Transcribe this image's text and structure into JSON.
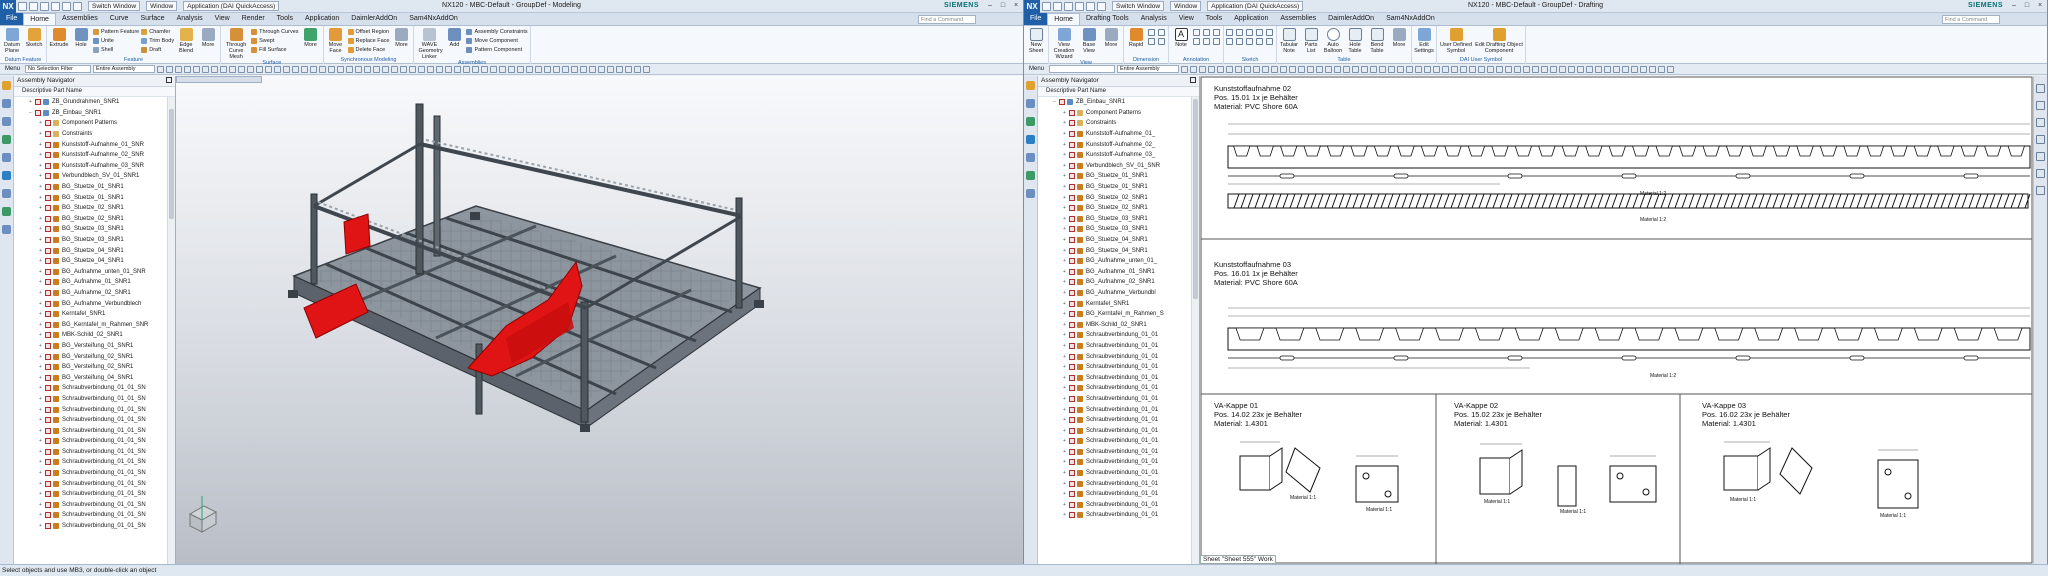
{
  "left": {
    "title": "NX120 - MBC-Default - GroupDef - Modeling",
    "logo": "NX",
    "siemens": "SIEMENS",
    "switch_window": "Switch Window",
    "window_menu": "Window",
    "application_menu": "Application (DAI QuickAccess)",
    "find_placeholder": "Find a Command",
    "tabs": [
      "File",
      "Home",
      "Assemblies",
      "Curve",
      "Surface",
      "Analysis",
      "View",
      "Render",
      "Tools",
      "Application",
      "DaimlerAddOn",
      "Sam4NxAddOn"
    ],
    "active_tab": "Home",
    "ribbon": {
      "datum_plane": "Datum Plane",
      "sketch": "Sketch",
      "extrude": "Extrude",
      "hole": "Hole",
      "pattern_feature": "Pattern Feature",
      "unite": "Unite",
      "shell": "Shell",
      "chamfer": "Chamfer",
      "trim_body": "Trim Body",
      "draft": "Draft",
      "edge_blend": "Edge Blend",
      "more": "More",
      "through_curve_mesh": "Through Curve Mesh",
      "through_curves": "Through Curves",
      "swept": "Swept",
      "fill_surface": "Fill Surface",
      "move_face": "Move Face",
      "offset_region": "Offset Region",
      "replace_face": "Replace Face",
      "delete_face": "Delete Face",
      "wave_geometry_linker": "WAVE Geometry Linker",
      "add": "Add",
      "assembly_constraints": "Assembly Constraints",
      "move_component": "Move Component",
      "pattern_component": "Pattern Component",
      "group_datum": "Datum Feature",
      "group_feature": "Feature",
      "group_surface": "Surface",
      "group_sync": "Synchronous Modeling",
      "group_assemblies": "Assemblies"
    },
    "toolbar2": {
      "menu": "Menu",
      "selection_filter": "No Selection Filter",
      "scope": "Entire Assembly"
    },
    "navigator": {
      "title": "Assembly Navigator",
      "column": "Descriptive Part Name",
      "nodes": [
        {
          "label": "ZB_Grundrahmen_SNR1",
          "level": 1,
          "kind": "ass",
          "exp": "+"
        },
        {
          "label": "ZB_Einbau_SNR1",
          "level": 1,
          "kind": "ass",
          "exp": "−"
        },
        {
          "label": "Component Patterns",
          "level": 2,
          "kind": "folder",
          "exp": "+"
        },
        {
          "label": "Constraints",
          "level": 2,
          "kind": "folder",
          "exp": "+"
        },
        {
          "label": "Kunststoff-Aufnahme_01_SNR",
          "level": 2,
          "kind": "part",
          "exp": "+"
        },
        {
          "label": "Kunststoff-Aufnahme_02_SNR",
          "level": 2,
          "kind": "part",
          "exp": "+"
        },
        {
          "label": "Kunststoff-Aufnahme_03_SNR",
          "level": 2,
          "kind": "part",
          "exp": "+"
        },
        {
          "label": "Verbundblech_SV_01_SNR1",
          "level": 2,
          "kind": "part",
          "exp": "+"
        },
        {
          "label": "BG_Stuetze_01_SNR1",
          "level": 2,
          "kind": "part",
          "exp": "+"
        },
        {
          "label": "BG_Stuetze_01_SNR1",
          "level": 2,
          "kind": "part",
          "exp": "+"
        },
        {
          "label": "BG_Stuetze_02_SNR1",
          "level": 2,
          "kind": "part",
          "exp": "+"
        },
        {
          "label": "BG_Stuetze_02_SNR1",
          "level": 2,
          "kind": "part",
          "exp": "+"
        },
        {
          "label": "BG_Stuetze_03_SNR1",
          "level": 2,
          "kind": "part",
          "exp": "+"
        },
        {
          "label": "BG_Stuetze_03_SNR1",
          "level": 2,
          "kind": "part",
          "exp": "+"
        },
        {
          "label": "BG_Stuetze_04_SNR1",
          "level": 2,
          "kind": "part",
          "exp": "+"
        },
        {
          "label": "BG_Stuetze_04_SNR1",
          "level": 2,
          "kind": "part",
          "exp": "+"
        },
        {
          "label": "BG_Aufnahme_unten_01_SNR",
          "level": 2,
          "kind": "part",
          "exp": "+"
        },
        {
          "label": "BG_Aufnahme_01_SNR1",
          "level": 2,
          "kind": "part",
          "exp": "+"
        },
        {
          "label": "BG_Aufnahme_02_SNR1",
          "level": 2,
          "kind": "part",
          "exp": "+"
        },
        {
          "label": "BG_Aufnahme_Verbundblech",
          "level": 2,
          "kind": "part",
          "exp": "+"
        },
        {
          "label": "Kerntafel_SNR1",
          "level": 2,
          "kind": "part",
          "exp": "+"
        },
        {
          "label": "BG_Kerntafel_m_Rahmen_SNR",
          "level": 2,
          "kind": "part",
          "exp": "+"
        },
        {
          "label": "MBK-Schild_02_SNR1",
          "level": 2,
          "kind": "part",
          "exp": "+"
        },
        {
          "label": "BG_Versteifung_01_SNR1",
          "level": 2,
          "kind": "part",
          "exp": "+"
        },
        {
          "label": "BG_Versteifung_02_SNR1",
          "level": 2,
          "kind": "part",
          "exp": "+"
        },
        {
          "label": "BG_Versteifung_02_SNR1",
          "level": 2,
          "kind": "part",
          "exp": "+"
        },
        {
          "label": "BG_Versteifung_04_SNR1",
          "level": 2,
          "kind": "part",
          "exp": "+"
        },
        {
          "label": "Schraubverbindung_01_01_SN",
          "level": 2,
          "kind": "part",
          "exp": "+"
        },
        {
          "label": "Schraubverbindung_01_01_SN",
          "level": 2,
          "kind": "part",
          "exp": "+"
        },
        {
          "label": "Schraubverbindung_01_01_SN",
          "level": 2,
          "kind": "part",
          "exp": "+"
        },
        {
          "label": "Schraubverbindung_01_01_SN",
          "level": 2,
          "kind": "part",
          "exp": "+"
        },
        {
          "label": "Schraubverbindung_01_01_SN",
          "level": 2,
          "kind": "part",
          "exp": "+"
        },
        {
          "label": "Schraubverbindung_01_01_SN",
          "level": 2,
          "kind": "part",
          "exp": "+"
        },
        {
          "label": "Schraubverbindung_01_01_SN",
          "level": 2,
          "kind": "part",
          "exp": "+"
        },
        {
          "label": "Schraubverbindung_01_01_SN",
          "level": 2,
          "kind": "part",
          "exp": "+"
        },
        {
          "label": "Schraubverbindung_01_01_SN",
          "level": 2,
          "kind": "part",
          "exp": "+"
        },
        {
          "label": "Schraubverbindung_01_01_SN",
          "level": 2,
          "kind": "part",
          "exp": "+"
        },
        {
          "label": "Schraubverbindung_01_01_SN",
          "level": 2,
          "kind": "part",
          "exp": "+"
        },
        {
          "label": "Schraubverbindung_01_01_SN",
          "level": 2,
          "kind": "part",
          "exp": "+"
        },
        {
          "label": "Schraubverbindung_01_01_SN",
          "level": 2,
          "kind": "part",
          "exp": "+"
        },
        {
          "label": "Schraubverbindung_01_01_SN",
          "level": 2,
          "kind": "part",
          "exp": "+"
        }
      ]
    }
  },
  "right": {
    "title": "NX120 - MBC-Default - GroupDef - Drafting",
    "logo": "NX",
    "siemens": "SIEMENS",
    "switch_window": "Switch Window",
    "window_menu": "Window",
    "application_menu": "Application (DAI QuickAccess)",
    "find_placeholder": "Find a Command",
    "tabs": [
      "File",
      "Home",
      "Drafting Tools",
      "Analysis",
      "View",
      "Tools",
      "Application",
      "Assemblies",
      "DaimlerAddOn",
      "Sam4NxAddOn"
    ],
    "active_tab": "Home",
    "ribbon": {
      "new_sheet": "New Sheet",
      "view_creation_wizard": "View Creation Wizard",
      "base_view": "Base View",
      "more": "More",
      "rapid": "Rapid",
      "note": "Note",
      "tabular_note": "Tabular Note",
      "parts_list": "Parts List",
      "auto_balloon": "Auto Balloon",
      "hole_table": "Hole Table",
      "bend_table": "Bend Table",
      "edit_settings": "Edit Settings",
      "user_defined_symbol": "User Defined Symbol",
      "edit_drafting_object_component": "Edit Drafting Object Component",
      "group_view": "View",
      "group_dimension": "Dimension",
      "group_annotation": "Annotation",
      "group_sketch": "Sketch",
      "group_table": "Table",
      "group_dai_user_symbol": "DAI User Symbol"
    },
    "toolbar2": {
      "menu": "Menu",
      "selection_filter": "",
      "scope": "Entire Assembly"
    },
    "navigator": {
      "title": "Assembly Navigator",
      "column": "Descriptive Part Name",
      "nodes": [
        {
          "label": "ZB_Einbau_SNR1",
          "level": 1,
          "kind": "ass",
          "exp": "−"
        },
        {
          "label": "Component Patterns",
          "level": 2,
          "kind": "folder",
          "exp": "+"
        },
        {
          "label": "Constraints",
          "level": 2,
          "kind": "folder",
          "exp": "+"
        },
        {
          "label": "Kunststoff-Aufnahme_01_",
          "level": 2,
          "kind": "part",
          "exp": "+"
        },
        {
          "label": "Kunststoff-Aufnahme_02_",
          "level": 2,
          "kind": "part",
          "exp": "+"
        },
        {
          "label": "Kunststoff-Aufnahme_03_",
          "level": 2,
          "kind": "part",
          "exp": "+"
        },
        {
          "label": "Verbundblech_SV_01_SNR",
          "level": 2,
          "kind": "part",
          "exp": "+"
        },
        {
          "label": "BG_Stuetze_01_SNR1",
          "level": 2,
          "kind": "part",
          "exp": "+"
        },
        {
          "label": "BG_Stuetze_01_SNR1",
          "level": 2,
          "kind": "part",
          "exp": "+"
        },
        {
          "label": "BG_Stuetze_02_SNR1",
          "level": 2,
          "kind": "part",
          "exp": "+"
        },
        {
          "label": "BG_Stuetze_02_SNR1",
          "level": 2,
          "kind": "part",
          "exp": "+"
        },
        {
          "label": "BG_Stuetze_03_SNR1",
          "level": 2,
          "kind": "part",
          "exp": "+"
        },
        {
          "label": "BG_Stuetze_03_SNR1",
          "level": 2,
          "kind": "part",
          "exp": "+"
        },
        {
          "label": "BG_Stuetze_04_SNR1",
          "level": 2,
          "kind": "part",
          "exp": "+"
        },
        {
          "label": "BG_Stuetze_04_SNR1",
          "level": 2,
          "kind": "part",
          "exp": "+"
        },
        {
          "label": "BG_Aufnahme_unten_01_",
          "level": 2,
          "kind": "part",
          "exp": "+"
        },
        {
          "label": "BG_Aufnahme_01_SNR1",
          "level": 2,
          "kind": "part",
          "exp": "+"
        },
        {
          "label": "BG_Aufnahme_02_SNR1",
          "level": 2,
          "kind": "part",
          "exp": "+"
        },
        {
          "label": "BG_Aufnahme_Verbundbl",
          "level": 2,
          "kind": "part",
          "exp": "+"
        },
        {
          "label": "Kerntafel_SNR1",
          "level": 2,
          "kind": "part",
          "exp": "+"
        },
        {
          "label": "BG_Kerntafel_m_Rahmen_S",
          "level": 2,
          "kind": "part",
          "exp": "+"
        },
        {
          "label": "MBK-Schild_02_SNR1",
          "level": 2,
          "kind": "part",
          "exp": "+"
        },
        {
          "label": "Schraubverbindung_01_01",
          "level": 2,
          "kind": "part",
          "exp": "+"
        },
        {
          "label": "Schraubverbindung_01_01",
          "level": 2,
          "kind": "part",
          "exp": "+"
        },
        {
          "label": "Schraubverbindung_01_01",
          "level": 2,
          "kind": "part",
          "exp": "+"
        },
        {
          "label": "Schraubverbindung_01_01",
          "level": 2,
          "kind": "part",
          "exp": "+"
        },
        {
          "label": "Schraubverbindung_01_01",
          "level": 2,
          "kind": "part",
          "exp": "+"
        },
        {
          "label": "Schraubverbindung_01_01",
          "level": 2,
          "kind": "part",
          "exp": "+"
        },
        {
          "label": "Schraubverbindung_01_01",
          "level": 2,
          "kind": "part",
          "exp": "+"
        },
        {
          "label": "Schraubverbindung_01_01",
          "level": 2,
          "kind": "part",
          "exp": "+"
        },
        {
          "label": "Schraubverbindung_01_01",
          "level": 2,
          "kind": "part",
          "exp": "+"
        },
        {
          "label": "Schraubverbindung_01_01",
          "level": 2,
          "kind": "part",
          "exp": "+"
        },
        {
          "label": "Schraubverbindung_01_01",
          "level": 2,
          "kind": "part",
          "exp": "+"
        },
        {
          "label": "Schraubverbindung_01_01",
          "level": 2,
          "kind": "part",
          "exp": "+"
        },
        {
          "label": "Schraubverbindung_01_01",
          "level": 2,
          "kind": "part",
          "exp": "+"
        },
        {
          "label": "Schraubverbindung_01_01",
          "level": 2,
          "kind": "part",
          "exp": "+"
        },
        {
          "label": "Schraubverbindung_01_01",
          "level": 2,
          "kind": "part",
          "exp": "+"
        },
        {
          "label": "Schraubverbindung_01_01",
          "level": 2,
          "kind": "part",
          "exp": "+"
        },
        {
          "label": "Schraubverbindung_01_01",
          "level": 2,
          "kind": "part",
          "exp": "+"
        },
        {
          "label": "Schraubverbindung_01_01",
          "level": 2,
          "kind": "part",
          "exp": "+"
        }
      ]
    },
    "drawing": {
      "section1": {
        "title": "Kunststoffaufnahme 02",
        "pos": "Pos. 15.01 1x je Behälter",
        "material": "Material: PVC Shore 60A",
        "mat_scale_1": "Material 1:2",
        "mat_scale_2": "Material 1:2"
      },
      "section2": {
        "title": "Kunststoffaufnahme 03",
        "pos": "Pos. 16.01 1x je Behälter",
        "material": "Material: PVC Shore 60A",
        "mat_scale": "Material 1:2"
      },
      "cap1": {
        "title": "VA-Kappe 01",
        "pos": "Pos. 14.02 23x je Behälter",
        "material": "Material: 1.4301",
        "scale_a": "Material 1:1",
        "scale_b": "Material 1:1"
      },
      "cap2": {
        "title": "VA-Kappe 02",
        "pos": "Pos. 15.02 23x je Behälter",
        "material": "Material: 1.4301",
        "scale_a": "Material 1:1",
        "scale_b": "Material 1:1"
      },
      "cap3": {
        "title": "VA-Kappe 03",
        "pos": "Pos. 16.02 23x je Behälter",
        "material": "Material: 1.4301",
        "scale_a": "Material 1:1",
        "scale_b": "Material 1:1"
      },
      "sheet_label": "Sheet \"Sheet 555\" Work"
    }
  },
  "status": "Select objects and use MB3, or double-click an object",
  "colors": {
    "nx_blue": "#1f5fa8",
    "highlight_red": "#e01414",
    "siemens_teal": "#0a6e74"
  }
}
